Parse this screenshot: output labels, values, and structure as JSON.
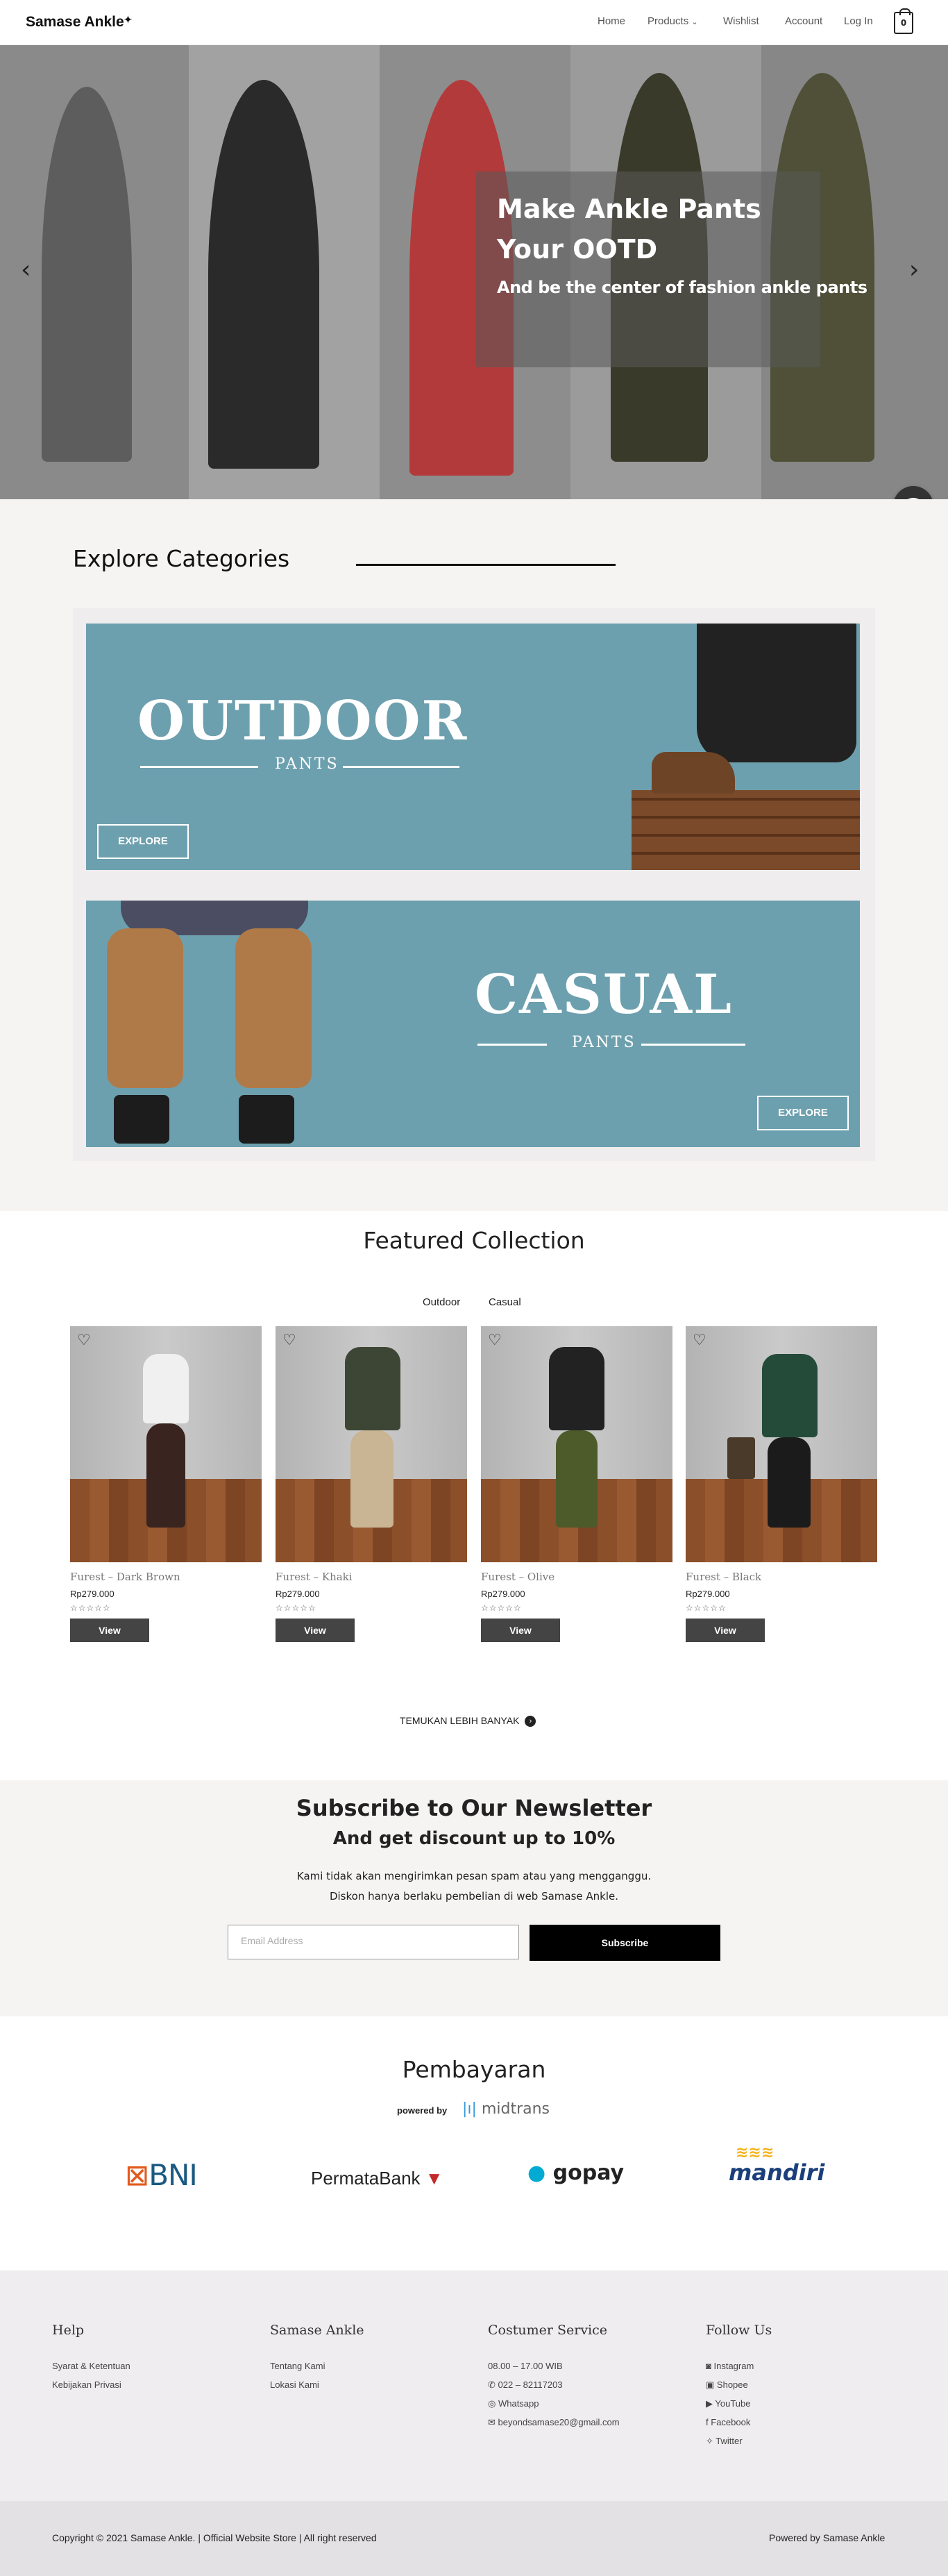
{
  "header": {
    "brand": "Samase Ankle",
    "nav": [
      "Home",
      "Products",
      "Wishlist",
      "Account",
      "Log In"
    ],
    "cart_count": "0"
  },
  "hero": {
    "title": "Make Ankle Pants Your OOTD",
    "subtitle": "And be the center of fashion ankle pants"
  },
  "categories": {
    "title": "Explore Categories",
    "banners": [
      {
        "name": "OUTDOOR",
        "sub": "PANTS",
        "button": "EXPLORE"
      },
      {
        "name": "CASUAL",
        "sub": "PANTS",
        "button": "EXPLORE"
      }
    ]
  },
  "featured": {
    "title": "Featured Collection",
    "tabs": [
      "Outdoor",
      "Casual"
    ],
    "products": [
      {
        "name": "Furest – Dark Brown",
        "price": "Rp279.000",
        "stars": "☆☆☆☆☆",
        "button": "View"
      },
      {
        "name": "Furest – Khaki",
        "price": "Rp279.000",
        "stars": "☆☆☆☆☆",
        "button": "View"
      },
      {
        "name": "Furest – Olive",
        "price": "Rp279.000",
        "stars": "☆☆☆☆☆",
        "button": "View"
      },
      {
        "name": "Furest – Black",
        "price": "Rp279.000",
        "stars": "☆☆☆☆☆",
        "button": "View"
      }
    ],
    "more": "TEMUKAN LEBIH BANYAK"
  },
  "newsletter": {
    "title": "Subscribe to Our Newsletter",
    "subtitle": "And get discount up to 10%",
    "line1": "Kami tidak akan mengirimkan pesan spam atau yang mengganggu.",
    "line2": "Diskon hanya berlaku pembelian di web Samase Ankle.",
    "email_placeholder": "Email Address",
    "button": "Subscribe"
  },
  "payment": {
    "title": "Pembayaran",
    "powered_by": "powered by",
    "provider": "midtrans",
    "logos": [
      "BNI",
      "PermataBank",
      "gopay",
      "mandiri"
    ]
  },
  "footer": {
    "help": {
      "title": "Help",
      "links": [
        "Syarat & Ketentuan",
        "Kebijakan Privasi"
      ]
    },
    "brand": {
      "title": "Samase Ankle",
      "links": [
        "Tentang Kami",
        "Lokasi Kami"
      ]
    },
    "service": {
      "title": "Costumer Service",
      "links": [
        "08.00 – 17.00 WIB",
        "022 – 82117203",
        "Whatsapp",
        "beyondsamase20@gmail.com"
      ]
    },
    "follow": {
      "title": "Follow Us",
      "links": [
        "Instagram",
        "Shopee",
        "YouTube",
        "Facebook",
        "Twitter"
      ]
    },
    "copyright": "Copyright © 2021 Samase Ankle. | Official Website Store | All right reserved",
    "powered": "Powered by Samase Ankle"
  }
}
